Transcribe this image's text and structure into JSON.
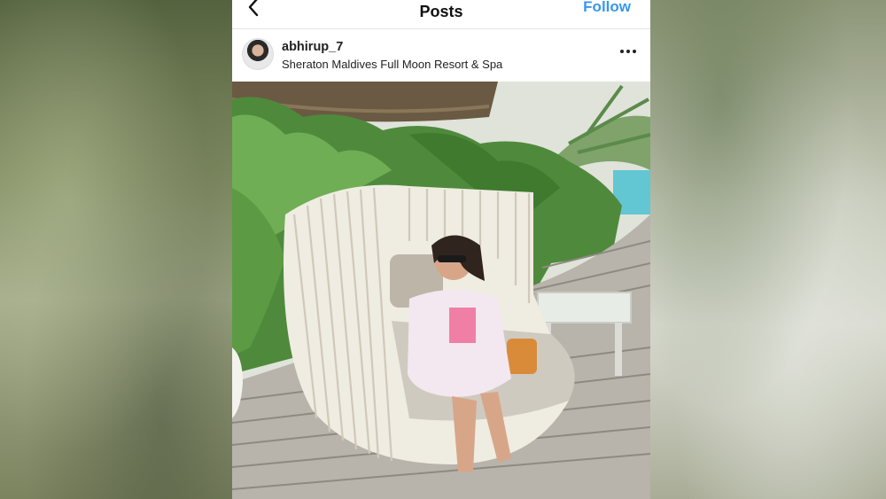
{
  "header": {
    "title": "Posts",
    "follow_label": "Follow"
  },
  "post": {
    "username": "abhirup_7",
    "location": "Sheraton Maldives Full Moon Resort & Spa"
  },
  "icons": {
    "back": "chevron-left-icon",
    "more": "more-horizontal-icon"
  },
  "colors": {
    "accent": "#3897f0"
  }
}
